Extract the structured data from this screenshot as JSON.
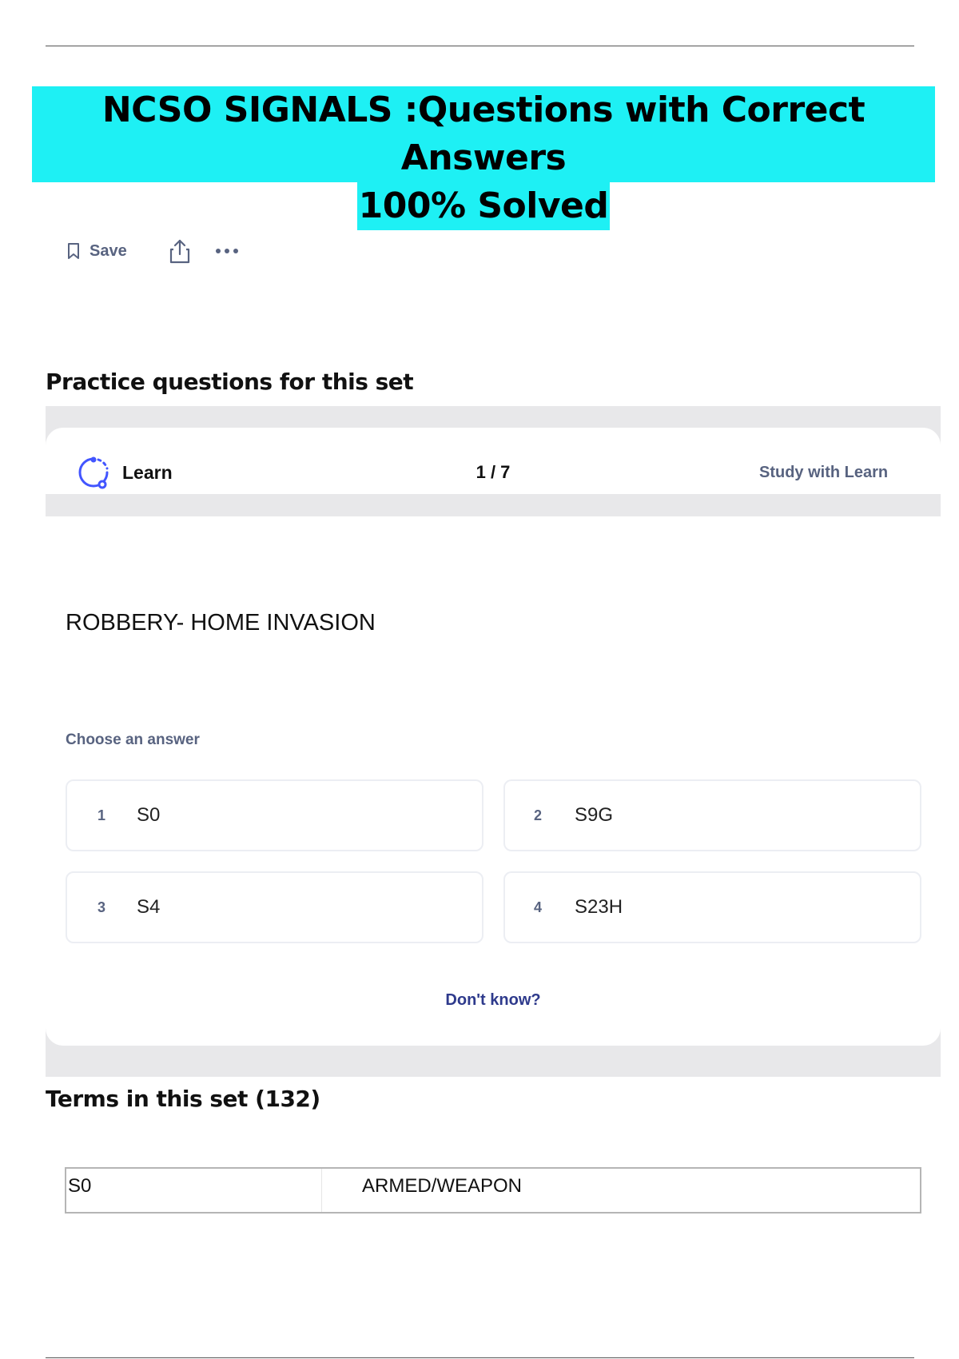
{
  "title": {
    "line1": "NCSO SIGNALS :Questions with Correct Answers",
    "line2": "100% Solved"
  },
  "actions": {
    "save_label": "Save",
    "share_icon": "share-icon",
    "more_icon": "more-icon"
  },
  "practice": {
    "heading": "Practice questions for this set",
    "mode_label": "Learn",
    "progress": "1 / 7",
    "study_link": "Study with Learn",
    "question": "ROBBERY- HOME INVASION",
    "choose_label": "Choose an answer",
    "options": [
      {
        "num": "1",
        "value": "S0"
      },
      {
        "num": "2",
        "value": "S9G"
      },
      {
        "num": "3",
        "value": "S4"
      },
      {
        "num": "4",
        "value": "S23H"
      }
    ],
    "dont_know": "Don't know?"
  },
  "terms": {
    "heading": "Terms in this set (132)",
    "rows": [
      {
        "term": "S0",
        "definition": "ARMED/WEAPON"
      }
    ]
  },
  "colors": {
    "title_highlight": "#1ef0f4",
    "panel_gray": "#e8e8ea",
    "muted_text": "#586380",
    "link_blue": "#2e3a8c",
    "learn_icon": "#4255ff"
  }
}
